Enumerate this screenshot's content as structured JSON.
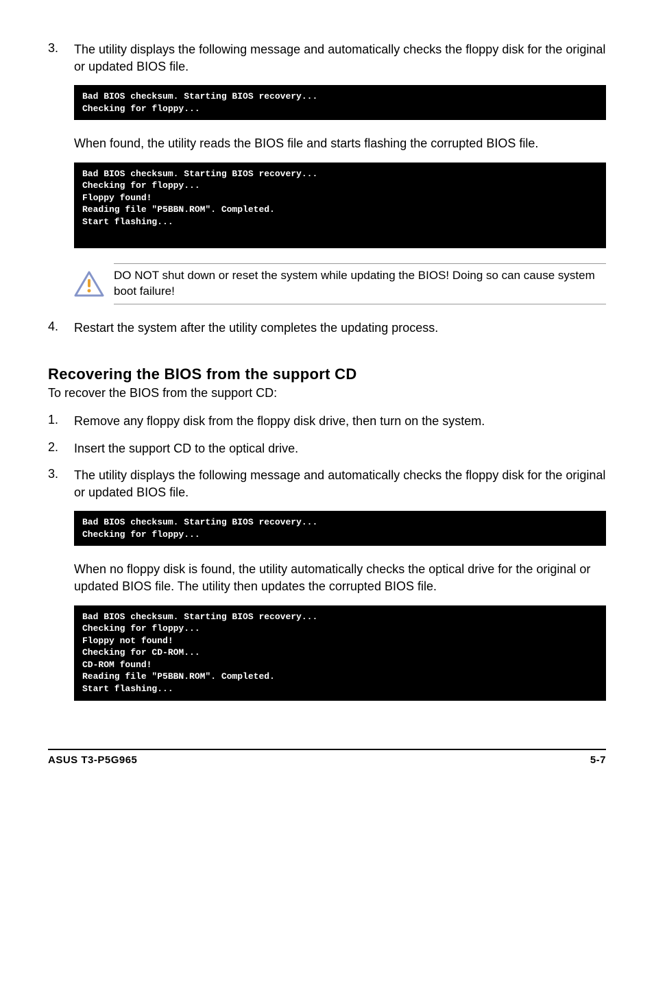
{
  "step3a": {
    "num": "3.",
    "text": "The utility displays the following message and automatically checks the floppy disk for the original or updated BIOS file."
  },
  "term1": "Bad BIOS checksum. Starting BIOS recovery...\nChecking for floppy...",
  "found_text": "When found, the utility reads the BIOS file and starts flashing the corrupted BIOS file.",
  "term2": "Bad BIOS checksum. Starting BIOS recovery...\nChecking for floppy...\nFloppy found!\nReading file \"P5BBN.ROM\". Completed.\nStart flashing...",
  "warning": "DO NOT shut down or reset the system while updating the BIOS! Doing so can cause system boot failure!",
  "step4": {
    "num": "4.",
    "text": "Restart the system after the utility completes the updating process."
  },
  "section_heading": "Recovering the BIOS from the support CD",
  "section_lead": "To recover the BIOS from the support CD:",
  "cd_step1": {
    "num": "1.",
    "text": "Remove any floppy disk from the floppy disk drive, then turn on the system."
  },
  "cd_step2": {
    "num": "2.",
    "text": "Insert the support CD to the optical drive."
  },
  "cd_step3": {
    "num": "3.",
    "text": "The utility displays the following message and automatically checks the floppy disk for the original or updated BIOS file."
  },
  "term3": "Bad BIOS checksum. Starting BIOS recovery...\nChecking for floppy...",
  "no_floppy_text": "When no floppy disk is found, the utility automatically checks the optical drive for the original or updated BIOS file. The utility then updates the corrupted BIOS file.",
  "term4": "Bad BIOS checksum. Starting BIOS recovery...\nChecking for floppy...\nFloppy not found!\nChecking for CD-ROM...\nCD-ROM found!\nReading file \"P5BBN.ROM\". Completed.\nStart flashing...",
  "footer_left": "ASUS T3-P5G965",
  "footer_right": "5-7"
}
